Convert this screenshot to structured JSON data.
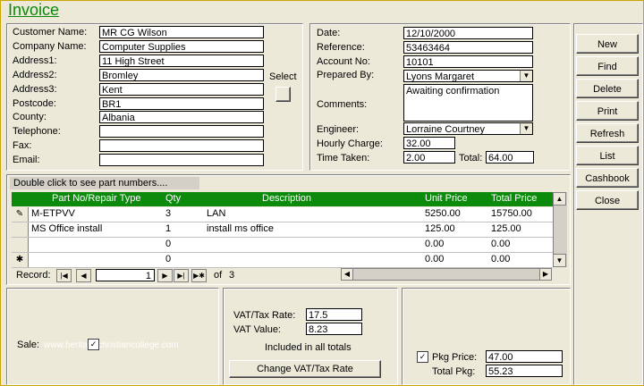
{
  "window": {
    "title": "Invoice"
  },
  "customer": {
    "labels": [
      "Customer Name:",
      "Company Name:",
      "Address1:",
      "Address2:",
      "Address3:",
      "Postcode:",
      "County:",
      "Telephone:",
      "Fax:",
      "Email:"
    ],
    "values": [
      "MR CG Wilson",
      "Computer Supplies",
      "11 High Street",
      "Bromley",
      "Kent",
      "BR1",
      "Albania",
      "",
      "",
      ""
    ],
    "select_label": "Select"
  },
  "invoice": {
    "date_label": "Date:",
    "date": "12/10/2000",
    "reference_label": "Reference:",
    "reference": "53463464",
    "account_label": "Account No:",
    "account": "10101",
    "prepared_label": "Prepared By:",
    "prepared": "Lyons Margaret",
    "comments_label": "Comments:",
    "comments": "Awaiting confirmation",
    "engineer_label": "Engineer:",
    "engineer": "Lorraine Courtney",
    "hourly_label": "Hourly Charge:",
    "hourly": "32.00",
    "time_label": "Time Taken:",
    "time": "2.00",
    "total_label": "Total:",
    "total": "64.00"
  },
  "buttons": {
    "new": "New",
    "find": "Find",
    "delete": "Delete",
    "print": "Print",
    "refresh": "Refresh",
    "list": "List",
    "cashbook": "Cashbook",
    "close": "Close"
  },
  "parts": {
    "hint": "Double click to see part numbers....",
    "headers": {
      "part": "Part No/Repair Type",
      "qty": "Qty",
      "desc": "Description",
      "unit": "Unit Price",
      "total": "Total Price"
    },
    "rows": [
      {
        "part": "M-ETPVV",
        "qty": "3",
        "desc": "LAN",
        "unit": "5250.00",
        "total": "15750.00"
      },
      {
        "part": "MS Office install",
        "qty": "1",
        "desc": "install ms office",
        "unit": "125.00",
        "total": "125.00"
      },
      {
        "part": "",
        "qty": "0",
        "desc": "",
        "unit": "0.00",
        "total": "0.00"
      },
      {
        "part": "",
        "qty": "0",
        "desc": "",
        "unit": "0.00",
        "total": "0.00"
      }
    ],
    "record_label": "Record:",
    "record_value": "1",
    "of_label": "of",
    "of_value": "3"
  },
  "sale": {
    "label": "Sale:",
    "watermark": "www.heritagechristiancollege.com"
  },
  "vat": {
    "rate_label": "VAT/Tax Rate:",
    "rate": "17.5",
    "value_label": "VAT Value:",
    "value": "8.23",
    "note": "Included in all totals",
    "change_button": "Change VAT/Tax Rate"
  },
  "pkg": {
    "price_label": "Pkg Price:",
    "price": "47.00",
    "total_label": "Total Pkg:",
    "total": "55.23"
  }
}
